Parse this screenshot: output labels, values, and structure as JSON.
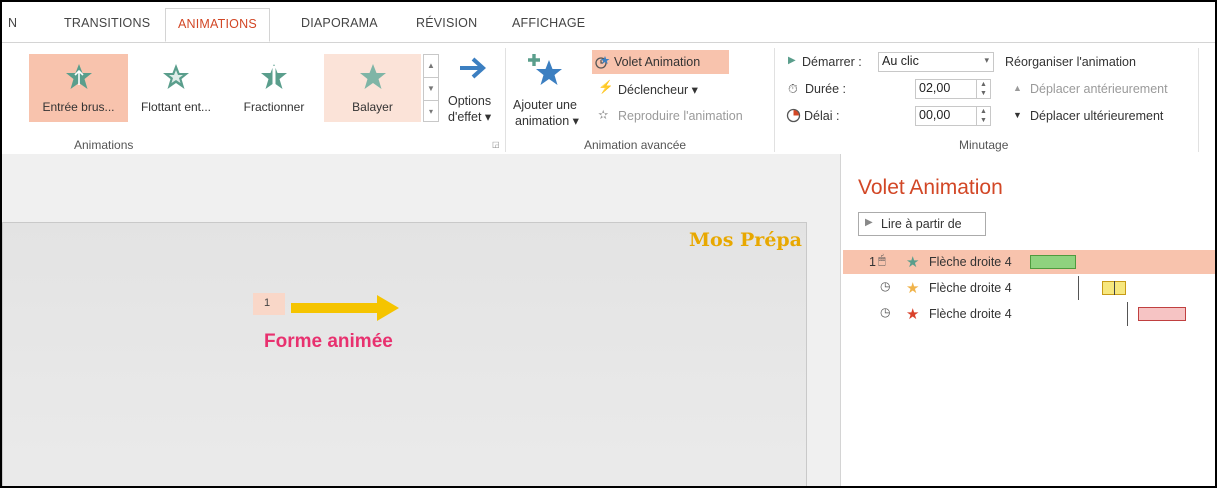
{
  "tabs": {
    "items": [
      {
        "label": "N"
      },
      {
        "label": "TRANSITIONS"
      },
      {
        "label": "ANIMATIONS"
      },
      {
        "label": "DIAPORAMA"
      },
      {
        "label": "RÉVISION"
      },
      {
        "label": "AFFICHAGE"
      }
    ],
    "active_index": 2
  },
  "animations_group": {
    "label": "Animations",
    "gallery": [
      {
        "label": "Entrée brus...",
        "icon": "star-entrance-icon",
        "selected": true
      },
      {
        "label": "Flottant ent...",
        "icon": "star-float-icon"
      },
      {
        "label": "Fractionner",
        "icon": "star-split-icon"
      },
      {
        "label": "Balayer",
        "icon": "star-wipe-icon",
        "hover": true
      }
    ],
    "effect_options": {
      "line1": "Options",
      "line2": "d'effet ▾"
    }
  },
  "advanced_group": {
    "label": "Animation avancée",
    "add_animation": {
      "line1": "Ajouter une",
      "line2": "animation ▾"
    },
    "animation_pane": "Volet Animation",
    "trigger": "Déclencheur ▾",
    "painter": "Reproduire l'animation"
  },
  "timing_group": {
    "label": "Minutage",
    "start_label": "Démarrer :",
    "start_value": "Au clic",
    "duration_label": "Durée :",
    "duration_value": "02,00",
    "delay_label": "Délai :",
    "delay_value": "00,00",
    "reorder_label": "Réorganiser l'animation",
    "move_earlier": "Déplacer antérieurement",
    "move_later": "Déplacer ultérieurement"
  },
  "slide": {
    "watermark": "Mos Prépa",
    "animation_tag": "1",
    "caption": "Forme animée"
  },
  "pane": {
    "title": "Volet Animation",
    "play_from": "Lire à partir de",
    "items": [
      {
        "index": "1",
        "name": "Flèche droite 4",
        "star_color": "#5a9e8c",
        "bar_color": "#8fd27e",
        "bar_border": "#4f9a3e",
        "selected": true
      },
      {
        "index": "",
        "name": "Flèche droite 4",
        "star_color": "#f0b34a",
        "bar_color": "#f7e77e",
        "bar_border": "#c89b16"
      },
      {
        "index": "",
        "name": "Flèche droite 4",
        "star_color": "#d9422b",
        "bar_color": "#f6c4c4",
        "bar_border": "#c04040"
      }
    ]
  },
  "colors": {
    "accent": "#d24726",
    "selected_bg": "#f8c3ad",
    "arrow": "#f5c400",
    "caption": "#e8316f",
    "watermark": "#e8a800"
  }
}
